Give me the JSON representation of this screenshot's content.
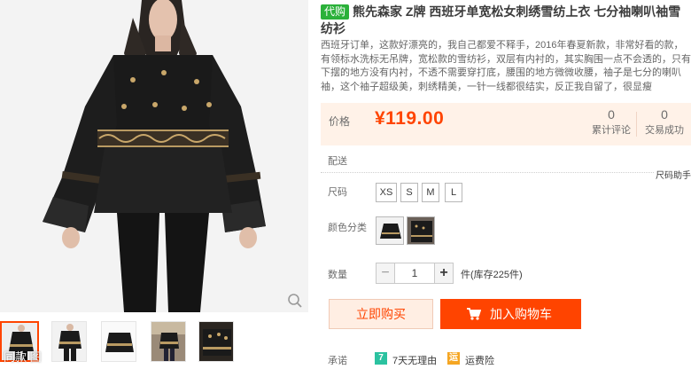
{
  "product": {
    "badge": "代购",
    "title": "熊先森家 Z牌 西班牙单宽松女刺绣雪纺上衣 七分袖喇叭袖雪纺衫",
    "subtitle": "西班牙订单，这款好漂亮的，我自己都爱不释手，2016年春夏新款，非常好看的款，有领标水洗标无吊牌，宽松款的雪纺衫，双层有内衬的，其实胸围一点不会透的，只有下摆的地方没有内衬，不透不需要穿打底，腰围的地方微微收腰，袖子是七分的喇叭袖，这个袖子超级美，刺绣精美，一针一线都很结实，反正我自留了，很显瘦"
  },
  "gallery": {
    "watermark": "同款 图",
    "thumb_count": 5
  },
  "price_panel": {
    "label": "价格",
    "price": "¥119.00",
    "reviews_count": "0",
    "reviews_label": "累计评论",
    "deals_count": "0",
    "deals_label": "交易成功"
  },
  "delivery": {
    "label": "配送",
    "helper": "尺码助手"
  },
  "size": {
    "label": "尺码",
    "options": [
      "XS",
      "S",
      "M",
      "L"
    ]
  },
  "color": {
    "label": "颜色分类"
  },
  "quantity": {
    "label": "数量",
    "minus": "−",
    "value": "1",
    "plus": "+",
    "stock": "件(库存225件)"
  },
  "actions": {
    "buy_now": "立即购买",
    "add_to_cart": "加入购物车"
  },
  "promise": {
    "label": "承诺",
    "return_icon": "7",
    "return_text": "7天无理由",
    "shipping_icon": "运",
    "shipping_text": "运费险"
  },
  "colors": {
    "accent": "#ff4400",
    "price_bg": "#fff2e8",
    "badge_green": "#2bb13a",
    "return_green": "#2bc2a0",
    "shipping_orange": "#f5a623"
  }
}
